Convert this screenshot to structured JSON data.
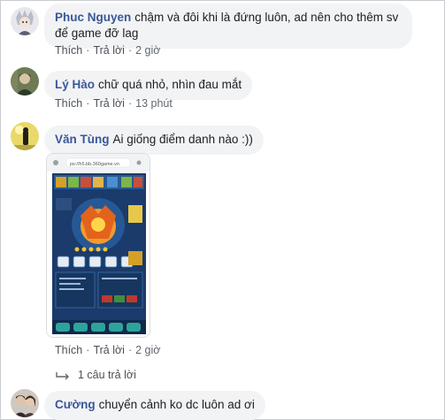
{
  "comments": [
    {
      "author": "Phuc Nguyen",
      "text": "chậm và đôi khi là đứng luôn, ad nên cho thêm sv để game đỡ lag",
      "like": "Thích",
      "reply": "Trả lời",
      "time": "2 giờ"
    },
    {
      "author": "Lý Hào",
      "text": "chữ quá nhỏ, nhìn đau mắt",
      "like": "Thích",
      "reply": "Trả lời",
      "time": "13 phút"
    },
    {
      "author": "Văn Tùng",
      "text": "Ai giống điểm danh nào :))",
      "like": "Thích",
      "reply": "Trả lời",
      "time": "2 giờ",
      "screenshot_url": "ps://h5.bb.360game.vn"
    },
    {
      "author": "Cường",
      "text": "chuyển cảnh ko dc luôn ad ơi"
    }
  ],
  "replies_link": "1 câu trả lời",
  "colors": {
    "author": "#385898",
    "bubble": "#f2f3f5",
    "meta": "#606770"
  }
}
